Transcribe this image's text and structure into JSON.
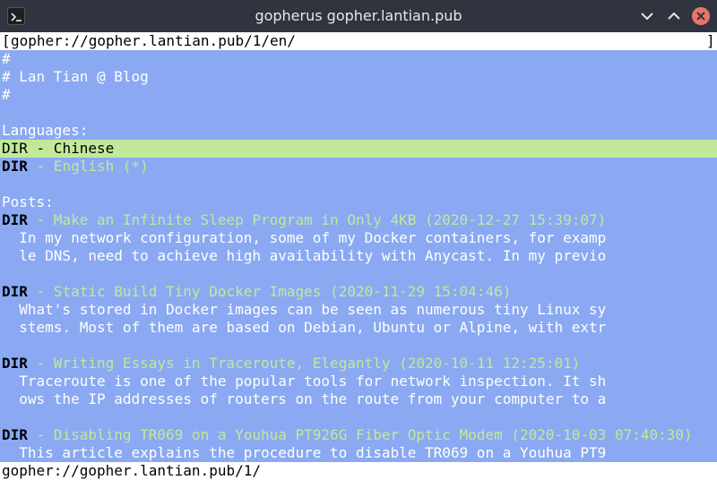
{
  "window": {
    "title": "gopherus gopher.lantian.pub"
  },
  "address_bar": {
    "left_bracket": "[",
    "url": "gopher://gopher.lantian.pub/1/en/",
    "right_bracket": "]"
  },
  "lines": [
    {
      "text": "#"
    },
    {
      "text": "# Lan Tian @ Blog"
    },
    {
      "text": "#"
    },
    {
      "text": ""
    },
    {
      "text": "Languages:"
    },
    {
      "tag": "DIR",
      "link": " - Chinese",
      "selected": true
    },
    {
      "tag": "DIR",
      "link": " - English (*)"
    },
    {
      "text": ""
    },
    {
      "text": "Posts:"
    },
    {
      "tag": "DIR",
      "link": " - Make an Infinite Sleep Program in Only 4KB (2020-12-27 15:39:07)"
    },
    {
      "text": "  In my network configuration, some of my Docker containers, for examp"
    },
    {
      "text": "  le DNS, need to achieve high availability with Anycast. In my previo"
    },
    {
      "text": ""
    },
    {
      "tag": "DIR",
      "link": " - Static Build Tiny Docker Images (2020-11-29 15:04:46)"
    },
    {
      "text": "  What's stored in Docker images can be seen as numerous tiny Linux sy"
    },
    {
      "text": "  stems. Most of them are based on Debian, Ubuntu or Alpine, with extr"
    },
    {
      "text": ""
    },
    {
      "tag": "DIR",
      "link": " - Writing Essays in Traceroute, Elegantly (2020-10-11 12:25:01)"
    },
    {
      "text": "  Traceroute is one of the popular tools for network inspection. It sh"
    },
    {
      "text": "  ows the IP addresses of routers on the route from your computer to a"
    },
    {
      "text": ""
    },
    {
      "tag": "DIR",
      "link": " - Disabling TR069 on a Youhua PT926G Fiber Optic Modem (2020-10-03 07:40:30)"
    },
    {
      "text": "  This article explains the procedure to disable TR069 on a Youhua PT9"
    }
  ],
  "status_bar": {
    "text": "gopher://gopher.lantian.pub/1/"
  },
  "colors": {
    "titlebar": "#2f343f",
    "background": "#8aa9f2",
    "link": "#c2e89a",
    "selection": "#c2e89a",
    "close_button": "#e8746d"
  },
  "icons": {
    "app": "terminal-icon",
    "minimize": "chevron-down-icon",
    "maximize": "chevron-up-icon",
    "close": "close-icon"
  }
}
